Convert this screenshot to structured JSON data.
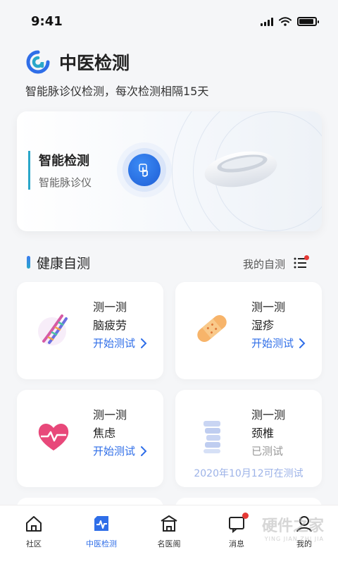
{
  "status": {
    "time": "9:41"
  },
  "header": {
    "title": "中医检测",
    "subtitle": "智能脉诊仪检测，每次检测相隔15天"
  },
  "main_card": {
    "title": "智能检测",
    "subtitle": "智能脉诊仪"
  },
  "section": {
    "title": "健康自测",
    "my_tests": "我的自测"
  },
  "tests": [
    {
      "line1": "测一测",
      "line2": "脑疲劳",
      "action": "开始测试",
      "note": ""
    },
    {
      "line1": "测一测",
      "line2": "湿疹",
      "action": "开始测试",
      "note": ""
    },
    {
      "line1": "测一测",
      "line2": "焦虑",
      "action": "开始测试",
      "note": ""
    },
    {
      "line1": "测一测",
      "line2": "颈椎",
      "action": "已测试",
      "note": "2020年10月12可在测试"
    }
  ],
  "tabs": [
    {
      "label": "社区",
      "icon": "home-icon"
    },
    {
      "label": "中医检测",
      "icon": "pulse-icon"
    },
    {
      "label": "名医阁",
      "icon": "pavilion-icon"
    },
    {
      "label": "消息",
      "icon": "message-icon"
    },
    {
      "label": "我的",
      "icon": "user-icon"
    }
  ],
  "watermark": {
    "text": "硬件之家",
    "sub": "YING JIAN ZHI JIA"
  },
  "colors": {
    "accent": "#2f6ee8",
    "teal": "#2aa7c9",
    "badge": "#e53935"
  }
}
